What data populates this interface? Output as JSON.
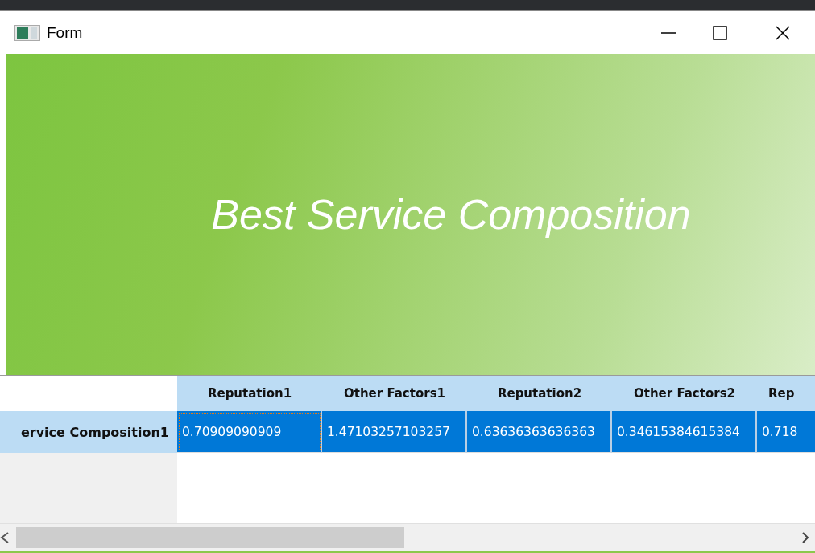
{
  "window": {
    "title": "Form"
  },
  "banner": {
    "title": "Best Service Composition"
  },
  "table": {
    "columns": [
      "Reputation1",
      "Other Factors1",
      "Reputation2",
      "Other Factors2",
      "Rep"
    ],
    "rows": [
      {
        "header": "ervice Composition1",
        "cells": [
          {
            "value": "0.70909090909",
            "selected": true,
            "focused": true
          },
          {
            "value": "1.47103257103257",
            "selected": true,
            "focused": false
          },
          {
            "value": "0.63636363636363",
            "selected": true,
            "focused": false
          },
          {
            "value": "0.34615384615384",
            "selected": true,
            "focused": false
          },
          {
            "value": "0.718",
            "selected": true,
            "focused": false
          }
        ]
      }
    ]
  }
}
